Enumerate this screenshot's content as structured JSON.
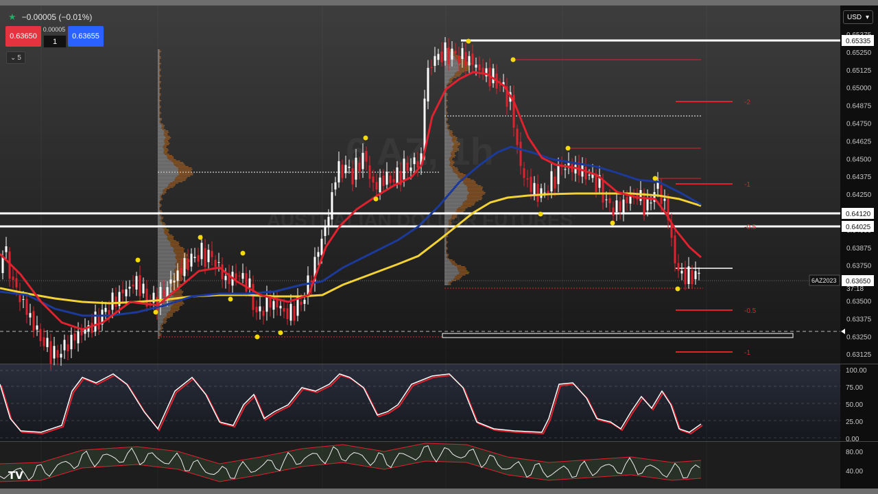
{
  "header": {
    "change_text": "−0.00005 (−0.01%)",
    "star_icon": "star-icon",
    "bid": "0.63650",
    "ask": "0.63655",
    "spread": "0.00005",
    "quantity": "1",
    "collapse_label": "5",
    "currency": "USD"
  },
  "watermark": {
    "symbol": "6 AZ, 1h",
    "name": "AUSTRALIAN DOLLAR FUTURES"
  },
  "colors": {
    "background": "#222222",
    "ema_red": "#e0222e",
    "ema_blue": "#1b3a9a",
    "sma_yellow": "#f2d236",
    "swing_dot": "#f5d90a",
    "bid_red": "#e5333f",
    "ask_blue": "#2962ff"
  },
  "price_axis": {
    "ticks": [
      "0.65375",
      "0.65250",
      "0.65125",
      "0.65000",
      "0.64875",
      "0.64750",
      "0.64625",
      "0.64500",
      "0.64375",
      "0.64250",
      "0.64125",
      "0.64000",
      "0.63875",
      "0.63750",
      "0.63625",
      "0.63500",
      "0.63375",
      "0.63250",
      "0.63125"
    ],
    "labels": [
      {
        "text": "0.65335",
        "style": "white"
      },
      {
        "text": "0.64120",
        "style": "white"
      },
      {
        "text": "0.64025",
        "style": "white"
      },
      {
        "text": "0.63650",
        "style": "white"
      }
    ],
    "symbol_tag": "6AZ2023",
    "countdown": "37:18"
  },
  "fib_labels": [
    "-2",
    "-1",
    "-0.5",
    "-0.5",
    "-1"
  ],
  "stoch": {
    "ticks": [
      "100.00",
      "75.00",
      "50.00",
      "25.00",
      "0.00"
    ]
  },
  "lower": {
    "ticks": [
      "80.00",
      "40.00"
    ]
  },
  "logo": "TV"
}
